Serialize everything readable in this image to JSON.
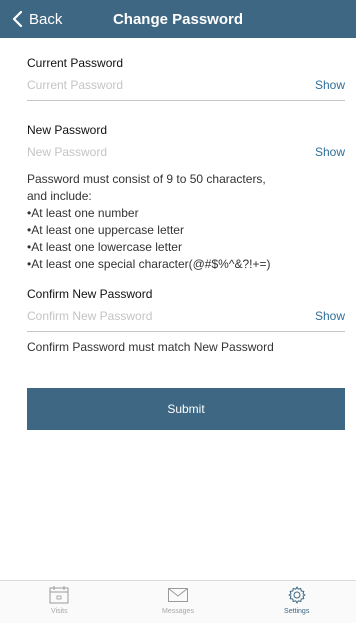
{
  "nav": {
    "back_label": "Back",
    "title": "Change Password"
  },
  "form": {
    "current": {
      "label": "Current Password",
      "placeholder": "Current Password",
      "show": "Show"
    },
    "new": {
      "label": "New Password",
      "placeholder": "New Password",
      "show": "Show"
    },
    "rules": {
      "intro_1": "Password must consist of 9 to 50 characters,",
      "intro_2": "and include:",
      "items": [
        "•At least one number",
        "•At least one uppercase letter",
        "•At least one lowercase letter",
        "•At least one special character(@#$%^&?!+=)"
      ]
    },
    "confirm": {
      "label": "Confirm New Password",
      "placeholder": "Confirm New Password",
      "show": "Show"
    },
    "confirm_hint": "Confirm Password must match New Password",
    "submit_label": "Submit"
  },
  "tabs": [
    {
      "label": "Visits",
      "icon": "calendar-icon",
      "active": false
    },
    {
      "label": "Messages",
      "icon": "envelope-icon",
      "active": false
    },
    {
      "label": "Settings",
      "icon": "gear-icon",
      "active": true
    }
  ],
  "colors": {
    "accent": "#3d6782",
    "link": "#2f6f99",
    "placeholder": "#c4c4c4"
  }
}
